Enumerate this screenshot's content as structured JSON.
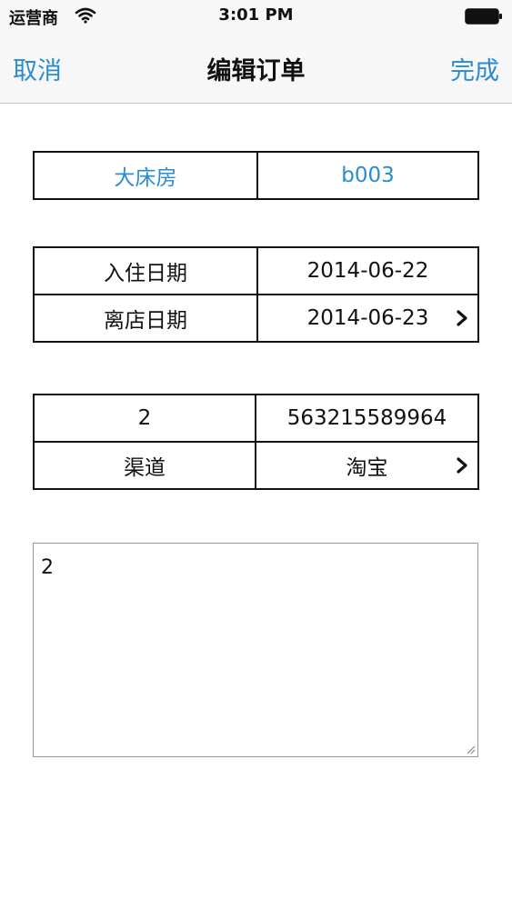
{
  "status_bar": {
    "carrier": "运营商",
    "time": "3:01 PM",
    "icons": [
      "wifi-icon",
      "battery-icon"
    ]
  },
  "nav": {
    "cancel_label": "取消",
    "title": "编辑订单",
    "done_label": "完成"
  },
  "room": {
    "type": "大床房",
    "number": "b003"
  },
  "dates": {
    "checkin_label": "入住日期",
    "checkin_value": "2014-06-22",
    "checkout_label": "离店日期",
    "checkout_value": "2014-06-23"
  },
  "order": {
    "guest_count": "2",
    "order_number": "563215589964",
    "channel_label": "渠道",
    "channel_value": "淘宝"
  },
  "memo": {
    "text": "2"
  },
  "colors": {
    "accent": "#2a8bd1",
    "bar_background": "#f7f7f8",
    "border": "#111111"
  }
}
